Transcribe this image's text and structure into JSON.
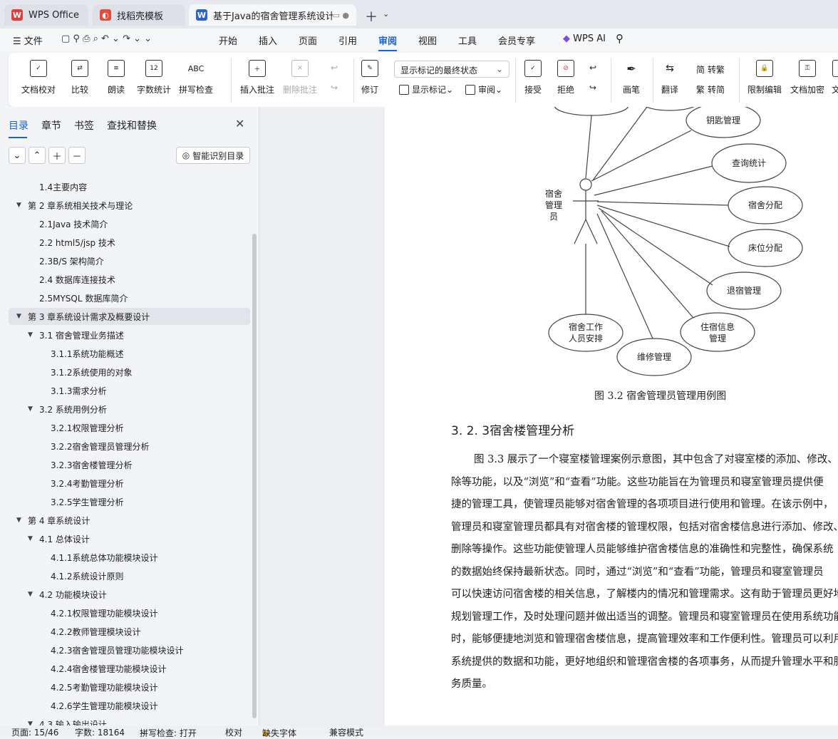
{
  "tabs": [
    {
      "label": "WPS Office",
      "icon": "wps-logo-icon"
    },
    {
      "label": "找稻壳模板",
      "icon": "docer-icon"
    },
    {
      "label": "基于Java的宿舍管理系统设计",
      "icon": "word-doc-icon"
    }
  ],
  "menu": {
    "file": "文件",
    "items": [
      "开始",
      "插入",
      "页面",
      "引用",
      "审阅",
      "视图",
      "工具",
      "会员专享"
    ],
    "active": "审阅",
    "wps_ai": "WPS AI"
  },
  "ribbon": {
    "doc_check": "文档校对",
    "compare": "比较",
    "read_aloud": "朗读",
    "word_count": "字数统计",
    "spell_check": "拼写检查",
    "spell_icon_text": "ABC",
    "count_icon_text": "12",
    "insert_comment": "插入批注",
    "delete_comment": "删除批注",
    "revise": "修订",
    "markup_select": "显示标记的最终状态",
    "show_markup": "显示标记",
    "review": "审阅",
    "accept": "接受",
    "reject": "拒绝",
    "pen": "画笔",
    "translate": "翻译",
    "to_traditional": "转繁",
    "to_simplified": "转简",
    "restrict_edit": "限制编辑",
    "doc_encrypt": "文档加密",
    "doc_cut": "文"
  },
  "left_pane": {
    "tabs": [
      "目录",
      "章节",
      "书签",
      "查找和替换"
    ],
    "smart_button": "智能识别目录",
    "toc": [
      {
        "label": "1.4主要内容",
        "level": 2,
        "arrow": ""
      },
      {
        "label": "第 2 章系统相关技术与理论",
        "level": 1,
        "arrow": "▼"
      },
      {
        "label": "2.1Java 技术简介",
        "level": 2,
        "arrow": ""
      },
      {
        "label": "2.2 html5/jsp 技术",
        "level": 2,
        "arrow": ""
      },
      {
        "label": "2.3B/S 架构简介",
        "level": 2,
        "arrow": ""
      },
      {
        "label": "2.4 数据库连接技术",
        "level": 2,
        "arrow": ""
      },
      {
        "label": "2.5MYSQL 数据库简介",
        "level": 2,
        "arrow": ""
      },
      {
        "label": "第 3 章系统设计需求及概要设计",
        "level": 1,
        "arrow": "▼",
        "selected": true
      },
      {
        "label": "3.1 宿舍管理业务描述",
        "level": 2,
        "arrow": "▼"
      },
      {
        "label": "3.1.1系统功能概述",
        "level": 3,
        "arrow": ""
      },
      {
        "label": "3.1.2系统使用的对象",
        "level": 3,
        "arrow": ""
      },
      {
        "label": "3.1.3需求分析",
        "level": 3,
        "arrow": ""
      },
      {
        "label": "3.2 系统用例分析",
        "level": 2,
        "arrow": "▼"
      },
      {
        "label": "3.2.1权限管理分析",
        "level": 3,
        "arrow": ""
      },
      {
        "label": "3.2.2宿舍管理员管理分析",
        "level": 3,
        "arrow": ""
      },
      {
        "label": "3.2.3宿舍楼管理分析",
        "level": 3,
        "arrow": ""
      },
      {
        "label": "3.2.4考勤管理分析",
        "level": 3,
        "arrow": ""
      },
      {
        "label": "3.2.5学生管理分析",
        "level": 3,
        "arrow": ""
      },
      {
        "label": "第 4 章系统设计",
        "level": 1,
        "arrow": "▼"
      },
      {
        "label": "4.1 总体设计",
        "level": 2,
        "arrow": "▼"
      },
      {
        "label": "4.1.1系统总体功能模块设计",
        "level": 3,
        "arrow": ""
      },
      {
        "label": "4.1.2系统设计原则",
        "level": 3,
        "arrow": ""
      },
      {
        "label": "4.2 功能模块设计",
        "level": 2,
        "arrow": "▼"
      },
      {
        "label": "4.2.1权限管理功能模块设计",
        "level": 3,
        "arrow": ""
      },
      {
        "label": "4.2.2教师管理模块设计",
        "level": 3,
        "arrow": ""
      },
      {
        "label": "4.2.3宿舍管理员管理功能模块设计",
        "level": 3,
        "arrow": ""
      },
      {
        "label": "4.2.4宿舍楼管理功能模块设计",
        "level": 3,
        "arrow": ""
      },
      {
        "label": "4.2.5考勤管理功能模块设计",
        "level": 3,
        "arrow": ""
      },
      {
        "label": "4.2.6学生管理功能模块设计",
        "level": 3,
        "arrow": ""
      },
      {
        "label": "4.3 输入输出设计",
        "level": 2,
        "arrow": "▼"
      }
    ]
  },
  "diagram": {
    "actor": [
      "宿舍",
      "管理",
      "员"
    ],
    "use_cases": [
      "钥匙管理",
      "查询统计",
      "宿舍分配",
      "床位分配",
      "退宿管理",
      "住宿信息管理",
      "维修管理",
      "宿舍工作人员安排"
    ],
    "use_case_lines": {
      "住宿信息管理": [
        "住宿信息",
        "管理"
      ],
      "宿舍工作人员安排": [
        "宿舍工作",
        "人员安排"
      ]
    }
  },
  "document": {
    "caption": "图 3.2 宿舍管理员管理用例图",
    "heading": "3. 2. 3宿舍楼管理分析",
    "lines": [
      "图 3.3 展示了一个寝室楼管理案例示意图，其中包含了对寝室楼的添加、修改、删",
      "除等功能，以及“浏览”和“查看”功能。这些功能旨在为管理员和寝室管理员提供便",
      "捷的管理工具，使管理员能够对宿舍管理的各项项目进行使用和管理。在该示例中，",
      "管理员和寝室管理员都具有对宿舍楼的管理权限，包括对宿舍楼信息进行添加、修改、",
      "删除等操作。这些功能使管理人员能够维护宿舍楼信息的准确性和完整性，确保系统",
      "的数据始终保持最新状态。同时，通过“浏览”和“查看”功能，管理员和寝室管理员",
      "可以快速访问宿舍楼的相关信息，了解楼内的情况和管理需求。这有助于管理员更好地",
      "规划管理工作，及时处理问题并做出适当的调整。管理员和寝室管理员在使用系统功能",
      "时，能够便捷地浏览和管理宿舍楼信息，提高管理效率和工作便利性。管理员可以利用",
      "系统提供的数据和功能，更好地组织和管理宿舍楼的各项事务，从而提升管理水平和服",
      "务质量。"
    ]
  },
  "status": {
    "page": "页面: 15/46",
    "words": "字数: 18164",
    "spell": "拼写检查: 打开",
    "proof": "校对",
    "missing_font": "缺失字体",
    "compat": "兼容模式"
  },
  "colors": {
    "accent": "#1a63d6",
    "wps_red": "#e23b3b"
  }
}
